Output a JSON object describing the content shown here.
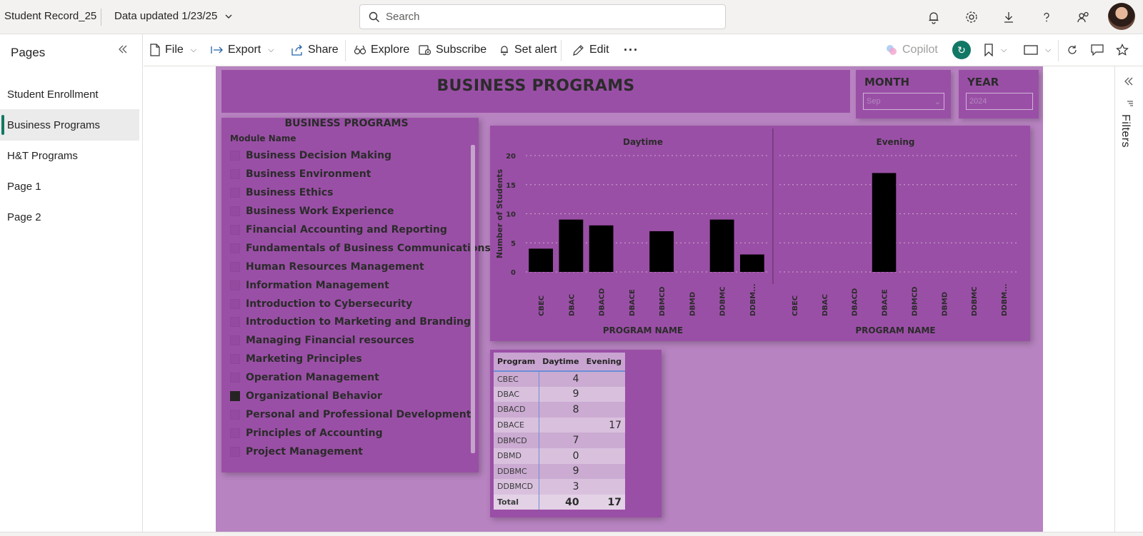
{
  "topbar": {
    "app_title": "Student Record_25",
    "data_updated": "Data updated 1/23/25",
    "search_placeholder": "Search"
  },
  "sidebar": {
    "title": "Pages",
    "items": [
      {
        "label": "Student Enrollment",
        "active": false
      },
      {
        "label": "Business Programs",
        "active": true
      },
      {
        "label": "H&T Programs",
        "active": false
      },
      {
        "label": "Page 1",
        "active": false
      },
      {
        "label": "Page 2",
        "active": false
      }
    ]
  },
  "toolbar": {
    "file": "File",
    "export": "Export",
    "share": "Share",
    "explore": "Explore",
    "subscribe": "Subscribe",
    "set_alert": "Set alert",
    "edit": "Edit",
    "more": "···",
    "copilot": "Copilot"
  },
  "report": {
    "title": "BUSINESS PROGRAMS",
    "month": {
      "label": "MONTH",
      "value": "Sep"
    },
    "year": {
      "label": "YEAR",
      "value": "2024"
    },
    "module_slicer": {
      "title": "BUSINESS PROGRAMS",
      "subtitle": "Module Name",
      "items": [
        {
          "label": "Business Decision Making",
          "checked": false
        },
        {
          "label": "Business Environment",
          "checked": false
        },
        {
          "label": "Business Ethics",
          "checked": false
        },
        {
          "label": "Business Work Experience",
          "checked": false
        },
        {
          "label": "Financial Accounting and Reporting",
          "checked": false
        },
        {
          "label": "Fundamentals of Business Communications",
          "checked": false
        },
        {
          "label": "Human Resources Management",
          "checked": false
        },
        {
          "label": "Information Management",
          "checked": false
        },
        {
          "label": "Introduction to Cybersecurity",
          "checked": false
        },
        {
          "label": "Introduction to Marketing and Branding",
          "checked": false
        },
        {
          "label": "Managing Financial resources",
          "checked": false
        },
        {
          "label": "Marketing Principles",
          "checked": false
        },
        {
          "label": "Operation Management",
          "checked": false
        },
        {
          "label": "Organizational Behavior",
          "checked": true
        },
        {
          "label": "Personal and Professional Development",
          "checked": false
        },
        {
          "label": "Principles of Accounting",
          "checked": false
        },
        {
          "label": "Project Management",
          "checked": false
        }
      ]
    },
    "table": {
      "headers": [
        "Program",
        "Daytime",
        "Evening"
      ],
      "rows": [
        [
          "CBEC",
          "4",
          ""
        ],
        [
          "DBAC",
          "9",
          ""
        ],
        [
          "DBACD",
          "8",
          ""
        ],
        [
          "DBACE",
          "",
          "17"
        ],
        [
          "DBMCD",
          "7",
          ""
        ],
        [
          "DBMD",
          "0",
          ""
        ],
        [
          "DDBMC",
          "9",
          ""
        ],
        [
          "DDBMCD",
          "3",
          ""
        ]
      ],
      "total": [
        "Total",
        "40",
        "17"
      ]
    },
    "filters_label": "Filters"
  },
  "chart_data": {
    "type": "bar",
    "ylabel": "Number of Students",
    "ylim": [
      0,
      20
    ],
    "yticks": [
      0,
      5,
      10,
      15,
      20
    ],
    "grid": true,
    "bar_color": "#000000",
    "panels": [
      {
        "title": "Daytime",
        "xlabel": "PROGRAM NAME",
        "tick_labels": [
          "CBEC",
          "DBAC",
          "DBACD",
          "DBACE",
          "DBMCD",
          "DBMD",
          "DDBMC",
          "DDBM..."
        ],
        "values": [
          4,
          9,
          8,
          0,
          7,
          0,
          9,
          3
        ]
      },
      {
        "title": "Evening",
        "xlabel": "PROGRAM NAME",
        "tick_labels": [
          "CBEC",
          "DBAC",
          "DBACD",
          "DBACE",
          "DBMCD",
          "DBMD",
          "DDBMC",
          "DDBM..."
        ],
        "values": [
          0,
          0,
          0,
          17,
          0,
          0,
          0,
          0
        ]
      }
    ]
  }
}
